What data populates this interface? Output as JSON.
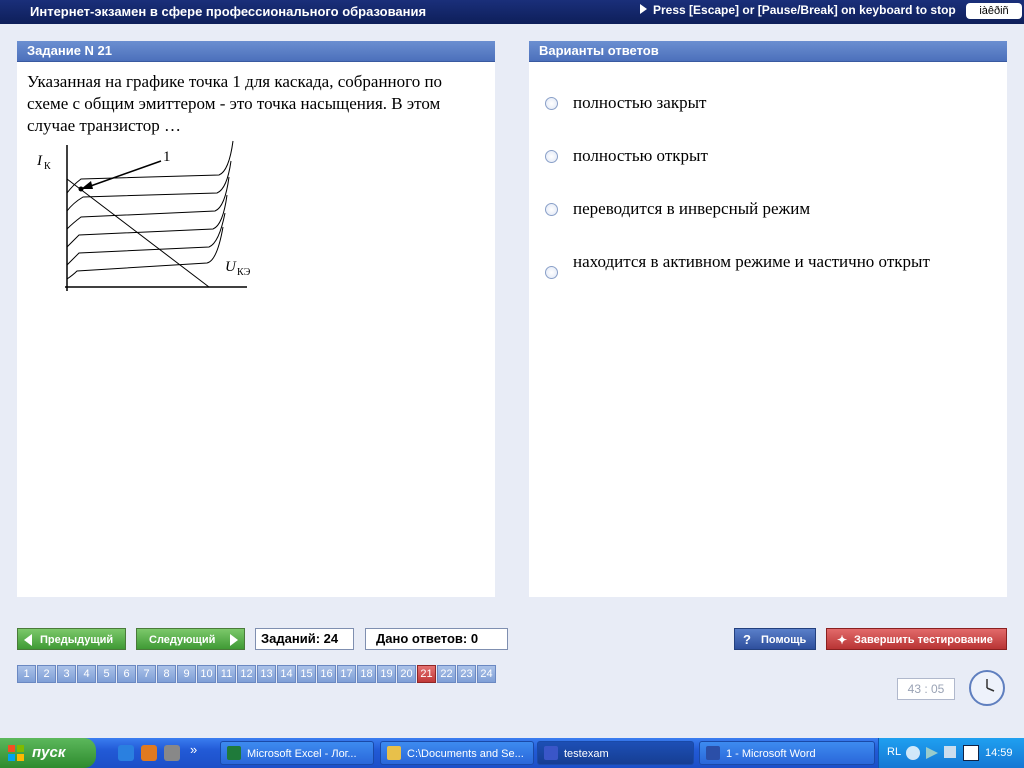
{
  "window": {
    "title": "Интернет-экзамен в сфере профессионального образования",
    "hint": "Press [Escape] or [Pause/Break] on keyboard to stop",
    "lang_box": "iàêðiñ"
  },
  "question": {
    "header": "Задание N 21",
    "text": "Указанная на графике точка 1 для каскада, собранного по схеме с общим эмиттером - это точка насыщения. В этом случае транзистор …",
    "graph": {
      "point_label": "1",
      "y_axis_label": "I",
      "y_axis_sub": "К",
      "x_axis_label": "U",
      "x_axis_sub": "КЭ"
    }
  },
  "answers": {
    "header": "Варианты ответов",
    "options": [
      "полностью закрыт",
      "полностью открыт",
      "переводится в инверсный режим",
      "находится в активном режиме и частично открыт"
    ]
  },
  "controls": {
    "prev": "Предыдущий",
    "next": "Следующий",
    "total": "Заданий: 24",
    "answered": "Дано ответов: 0",
    "help": "Помощь",
    "finish": "Завершить тестирование",
    "pages": [
      "1",
      "2",
      "3",
      "4",
      "5",
      "6",
      "7",
      "8",
      "9",
      "10",
      "11",
      "12",
      "13",
      "14",
      "15",
      "16",
      "17",
      "18",
      "19",
      "20",
      "21",
      "22",
      "23",
      "24"
    ],
    "active_page": "21",
    "timer": "43 : 05"
  },
  "taskbar": {
    "start": "пуск",
    "chevron": "»",
    "items": [
      {
        "label": "Microsoft Excel - Лог...",
        "icon": "excel-icon",
        "color": "#1f7a3a"
      },
      {
        "label": "C:\\Documents and Se...",
        "icon": "folder-icon",
        "color": "#e8c04a"
      },
      {
        "label": "testexam",
        "icon": "app-icon",
        "color": "#3a56c8"
      },
      {
        "label": "1 - Microsoft Word",
        "icon": "word-icon",
        "color": "#2b4fa8"
      }
    ],
    "lang": "RL",
    "time": "14:59"
  }
}
